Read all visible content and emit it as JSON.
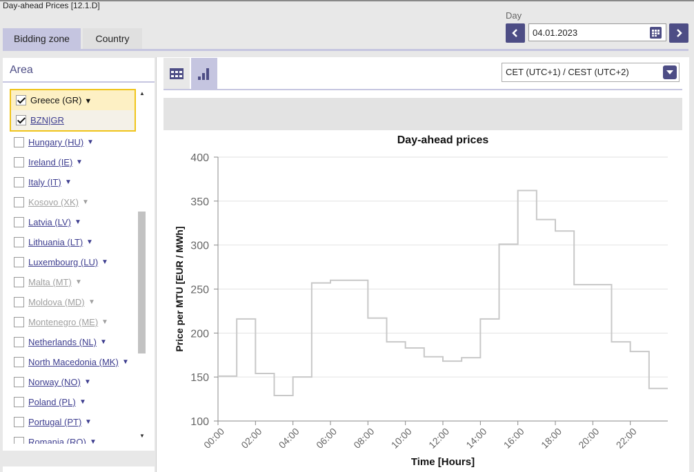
{
  "page": {
    "title": "Day-ahead Prices [12.1.D]"
  },
  "tabs": [
    {
      "label": "Bidding zone",
      "active": true
    },
    {
      "label": "Country",
      "active": false
    }
  ],
  "day": {
    "label": "Day",
    "value": "04.01.2023",
    "prev_icon": "chevron-left-icon",
    "next_icon": "chevron-right-icon",
    "calendar_icon": "calendar-icon"
  },
  "area": {
    "title": "Area",
    "selected": [
      {
        "label": "Greece (GR)",
        "checked": true,
        "has_dropdown": true
      },
      {
        "label": "BZN|GR",
        "checked": true,
        "has_dropdown": false
      }
    ],
    "items": [
      {
        "label": "Hungary (HU)",
        "disabled": false
      },
      {
        "label": "Ireland (IE)",
        "disabled": false
      },
      {
        "label": "Italy (IT)",
        "disabled": false
      },
      {
        "label": "Kosovo (XK)",
        "disabled": true
      },
      {
        "label": "Latvia (LV)",
        "disabled": false
      },
      {
        "label": "Lithuania (LT)",
        "disabled": false
      },
      {
        "label": "Luxembourg (LU)",
        "disabled": false
      },
      {
        "label": "Malta (MT)",
        "disabled": true
      },
      {
        "label": "Moldova (MD)",
        "disabled": true
      },
      {
        "label": "Montenegro (ME)",
        "disabled": true
      },
      {
        "label": "Netherlands (NL)",
        "disabled": false
      },
      {
        "label": "North Macedonia (MK)",
        "disabled": false
      },
      {
        "label": "Norway (NO)",
        "disabled": false
      },
      {
        "label": "Poland (PL)",
        "disabled": false
      },
      {
        "label": "Portugal (PT)",
        "disabled": false
      },
      {
        "label": "Romania (RO)",
        "disabled": false
      }
    ]
  },
  "toolbar": {
    "table_icon": "table-icon",
    "chart_icon": "bar-chart-icon",
    "timezone": "CET (UTC+1) / CEST (UTC+2)"
  },
  "colors": {
    "accent": "#4d4d85",
    "tab_active": "#c5c5e0",
    "highlight": "#f0c419",
    "line": "#c8c8c8"
  },
  "chart_data": {
    "type": "line",
    "step": true,
    "title": "Day-ahead prices",
    "xlabel": "Time [Hours]",
    "ylabel": "Price per MTU [EUR / MWh]",
    "ylim": [
      100,
      400
    ],
    "yticks": [
      100,
      150,
      200,
      250,
      300,
      350,
      400
    ],
    "xticks": [
      "00:00",
      "02:00",
      "04:00",
      "06:00",
      "08:00",
      "10:00",
      "12:00",
      "14:00",
      "16:00",
      "18:00",
      "20:00",
      "22:00"
    ],
    "grid": true,
    "x": [
      "00:00",
      "01:00",
      "02:00",
      "03:00",
      "04:00",
      "05:00",
      "06:00",
      "07:00",
      "08:00",
      "09:00",
      "10:00",
      "11:00",
      "12:00",
      "13:00",
      "14:00",
      "15:00",
      "16:00",
      "17:00",
      "18:00",
      "19:00",
      "20:00",
      "21:00",
      "22:00",
      "23:00"
    ],
    "series": [
      {
        "values": [
          151,
          216,
          154,
          129,
          150,
          257,
          260,
          260,
          217,
          190,
          183,
          173,
          168,
          172,
          216,
          301,
          362,
          329,
          316,
          255,
          255,
          190,
          179,
          137
        ]
      }
    ]
  }
}
